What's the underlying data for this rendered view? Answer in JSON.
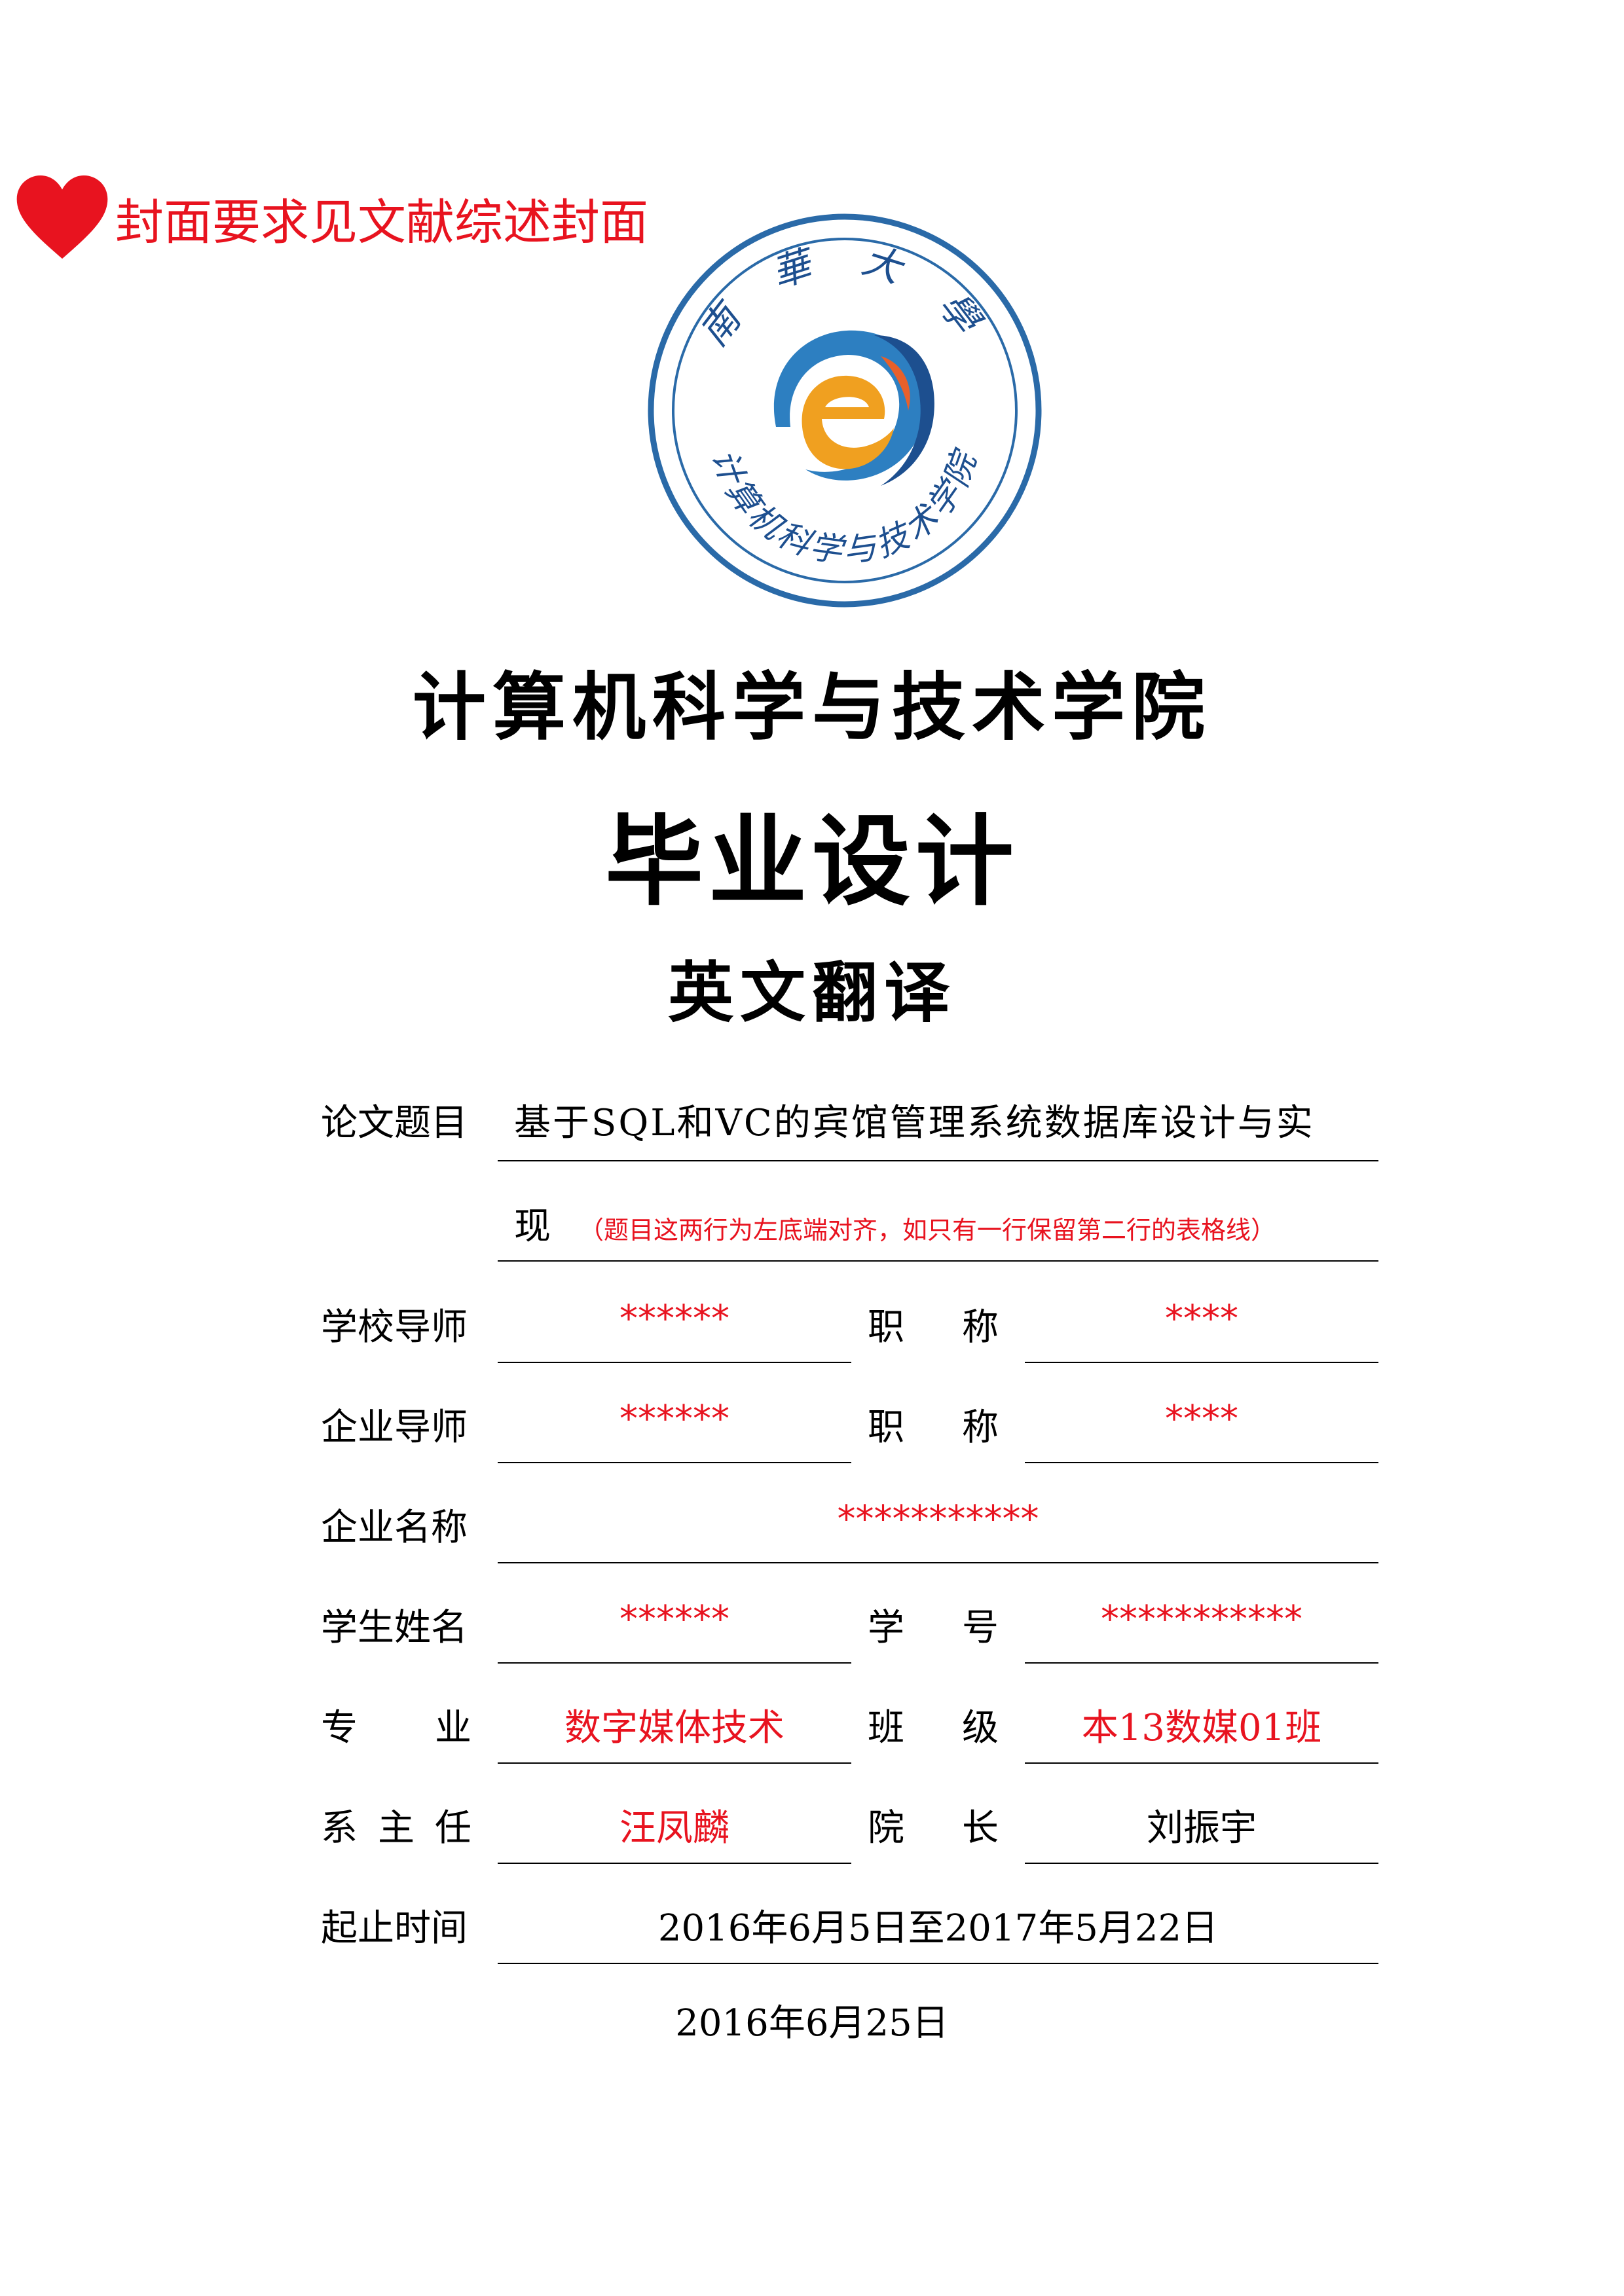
{
  "note": {
    "icon": "heart-icon",
    "text": "封面要求见文献综述封面",
    "color": "#e8131f"
  },
  "seal": {
    "top_text": "南 華 大 學",
    "bottom_text": "计算机科学与技术学院",
    "ring_color": "#2a6aa8"
  },
  "header": {
    "college": "计算机科学与技术学院",
    "title": "毕业设计",
    "subtitle": "英文翻译"
  },
  "form": {
    "thesis": {
      "label": "论文题目",
      "line1": "基于SQL和VC的宾馆管理系统数据库设计与实",
      "line2": "现",
      "hint": "（题目这两行为左底端对齐，如只有一行保留第二行的表格线）"
    },
    "school_advisor": {
      "label": "学校导师",
      "value": "******",
      "title_label": "职 称",
      "title_value": "****"
    },
    "company_advisor": {
      "label": "企业导师",
      "value": "******",
      "title_label": "职 称",
      "title_value": "****"
    },
    "company": {
      "label": "企业名称",
      "value": "***********"
    },
    "student": {
      "label": "学生姓名",
      "value": "******",
      "id_label": "学 号",
      "id_value": "***********"
    },
    "major": {
      "label": "专 业",
      "value": "数字媒体技术",
      "class_label": "班 级",
      "class_value": "本13数媒01班"
    },
    "dept": {
      "label": "系 主 任",
      "value": "汪凤麟",
      "dean_label": "院 长",
      "dean_value": "刘振宇"
    },
    "period": {
      "label": "起止时间",
      "value": "2016年6月5日至2017年5月22日"
    }
  },
  "date": "2016年6月25日"
}
